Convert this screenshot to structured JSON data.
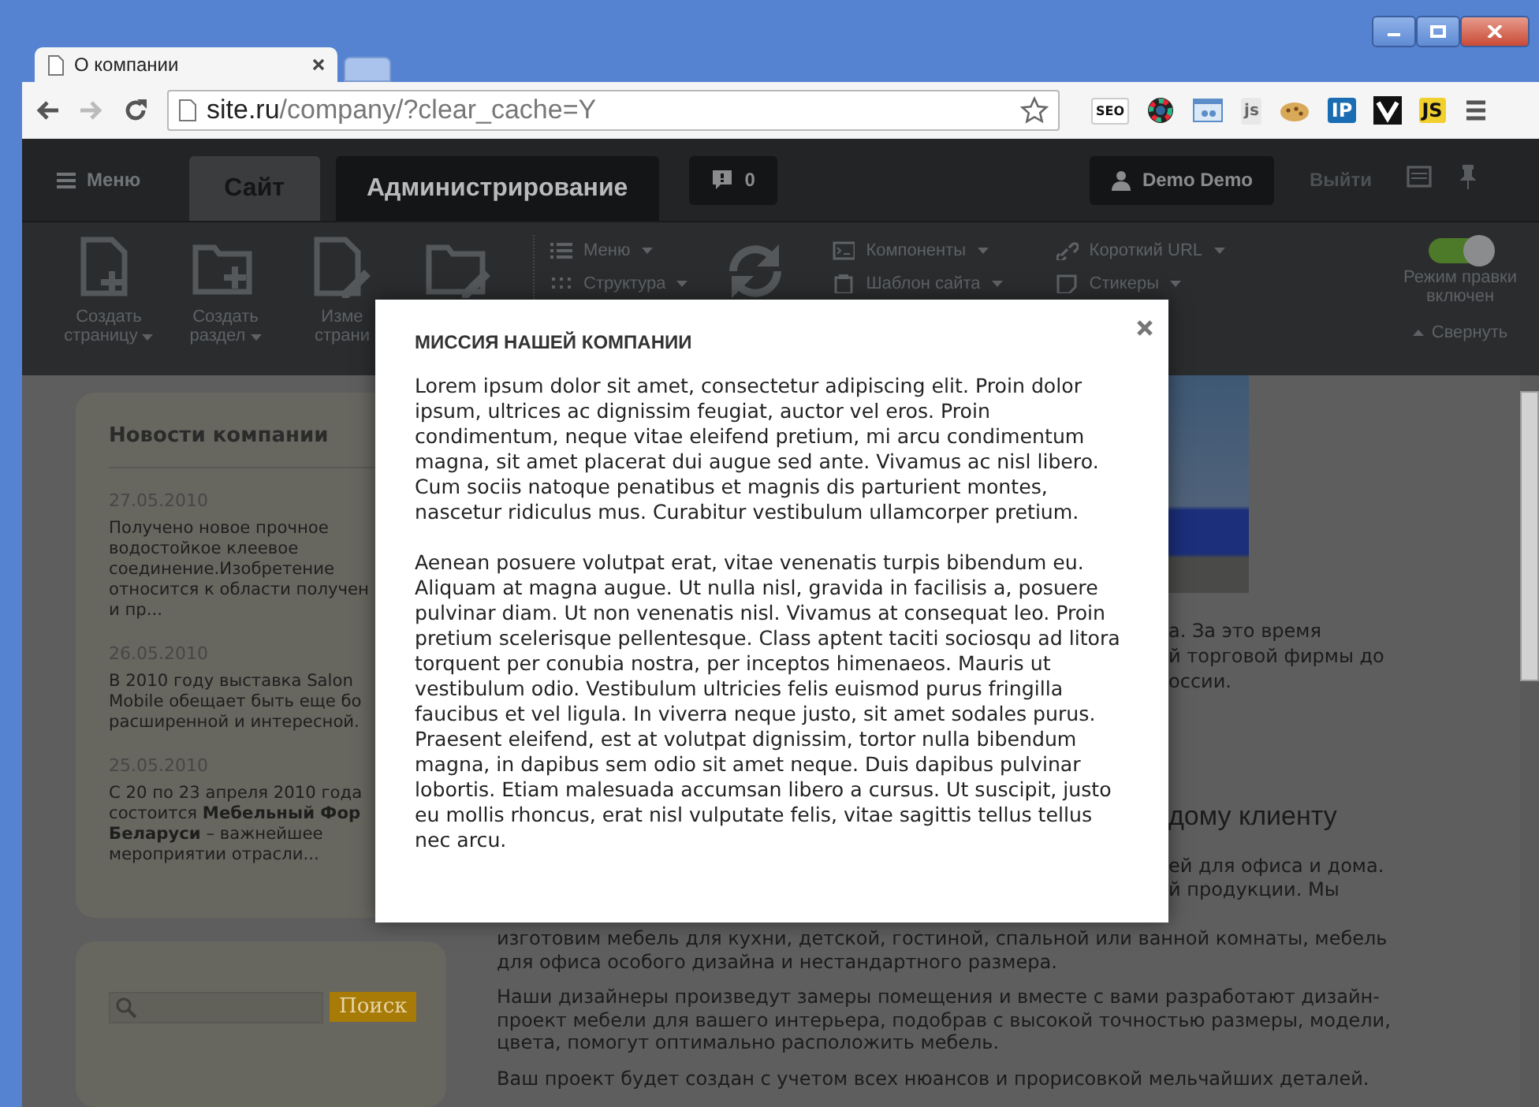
{
  "browser": {
    "tab_title": "О компании",
    "url_host": "site.ru",
    "url_path": "/company/?clear_cache=Y",
    "extensions": [
      {
        "kind": "seo",
        "label": "SEO"
      },
      {
        "kind": "color-wheel"
      },
      {
        "kind": "window"
      },
      {
        "kind": "gear-js",
        "label": "js"
      },
      {
        "kind": "cookie"
      },
      {
        "kind": "ip",
        "label": "IP"
      },
      {
        "kind": "chevron"
      },
      {
        "kind": "js",
        "label": "JS"
      }
    ]
  },
  "admin": {
    "menu": "Меню",
    "tabs": [
      {
        "label": "Сайт",
        "selected": true
      },
      {
        "label": "Администрирование",
        "selected": false
      }
    ],
    "notifications": "0",
    "user": "Demo Demo",
    "logout": "Выйти"
  },
  "toolbar": {
    "big_buttons": [
      {
        "label": "Создать\nстраницу",
        "dropdown": true
      },
      {
        "label": "Создать\nраздел",
        "dropdown": true
      },
      {
        "label": "Изме\nстрани",
        "dropdown": false
      }
    ],
    "menu_columns": [
      [
        {
          "label": "Меню"
        },
        {
          "label": "Структура"
        }
      ],
      [
        {
          "label": "Компоненты"
        },
        {
          "label": "Шаблон сайта"
        }
      ],
      [
        {
          "label": "Короткий URL"
        },
        {
          "label": "Стикеры"
        }
      ]
    ],
    "edit_mode": {
      "label": "Режим правки\nвключен",
      "on": true
    },
    "collapse": "Свернуть"
  },
  "sidebar": {
    "title": "Новости компании",
    "news": [
      {
        "date": "27.05.2010",
        "lines": [
          "Получено новое прочное",
          "водостойкое клеевое",
          "соединение.Изобретение",
          "относится к области получен",
          "и пр..."
        ]
      },
      {
        "date": "26.05.2010",
        "lines": [
          "В 2010 году выставка Salon",
          "Mobile обещает быть еще бо",
          "расширенной и интересной."
        ]
      },
      {
        "date": "25.05.2010",
        "lines": [
          "С 20 по 23 апреля 2010 года",
          "состоится **Мебельный Фор**",
          "**Беларуси** – важнейшее",
          "мероприятии отрасли..."
        ]
      }
    ],
    "search": {
      "button": "Поиск"
    }
  },
  "main": {
    "upper_lines": [
      "а. За это время",
      "й торговой фирмы до",
      "оссии."
    ],
    "heading": "дому клиенту",
    "middle_lines": [
      "ей для офиса и дома.",
      "й продукции. Мы"
    ],
    "paragraphs": [
      [
        "изготовим мебель для кухни, детской, гостиной, спальной или ванной комнаты, мебель",
        "для офиса особого дизайна и нестандартного размера."
      ],
      [
        "Наши дизайнеры произведут замеры помещения и вместе с вами разработают дизайн-",
        "проект мебели для вашего интерьера, подобрав с высокой точностью размеры, модели,",
        "цвета, помогут оптимально расположить мебель."
      ],
      [
        "Ваш проект будет создан с учетом всех нюансов и прорисовкой мельчайших деталей."
      ]
    ]
  },
  "modal": {
    "title": "МИССИЯ НАШЕЙ КОМПАНИИ",
    "paragraphs": [
      "Lorem ipsum dolor sit amet, consectetur adipiscing elit. Proin dolor ipsum, ultrices ac dignissim feugiat, auctor vel eros. Proin condimentum, neque vitae eleifend pretium, mi arcu condimentum magna, sit amet placerat dui augue sed ante. Vivamus ac nisl libero. Cum sociis natoque penatibus et magnis dis parturient montes, nascetur ridiculus mus. Curabitur vestibulum ullamcorper pretium.",
      "Aenean posuere volutpat erat, vitae venenatis turpis bibendum eu. Aliquam at magna augue. Ut nulla nisl, gravida in facilisis a, posuere pulvinar diam. Ut non venenatis nisl. Vivamus at consequat leo. Proin pretium scelerisque pellentesque. Class aptent taciti sociosqu ad litora torquent per conubia nostra, per inceptos himenaeos. Mauris ut vestibulum odio. Vestibulum ultricies felis euismod purus fringilla faucibus et vel ligula. In viverra neque justo, sit amet sodales purus. Praesent eleifend, est at volutpat dignissim, tortor nulla bibendum magna, in dapibus sem odio sit amet neque. Duis dapibus pulvinar lobortis. Etiam malesuada accumsan libero a cursus. Ut suscipit, justo eu mollis rhoncus, erat nisl vulputate felis, vitae sagittis tellus tellus nec arcu."
    ]
  }
}
